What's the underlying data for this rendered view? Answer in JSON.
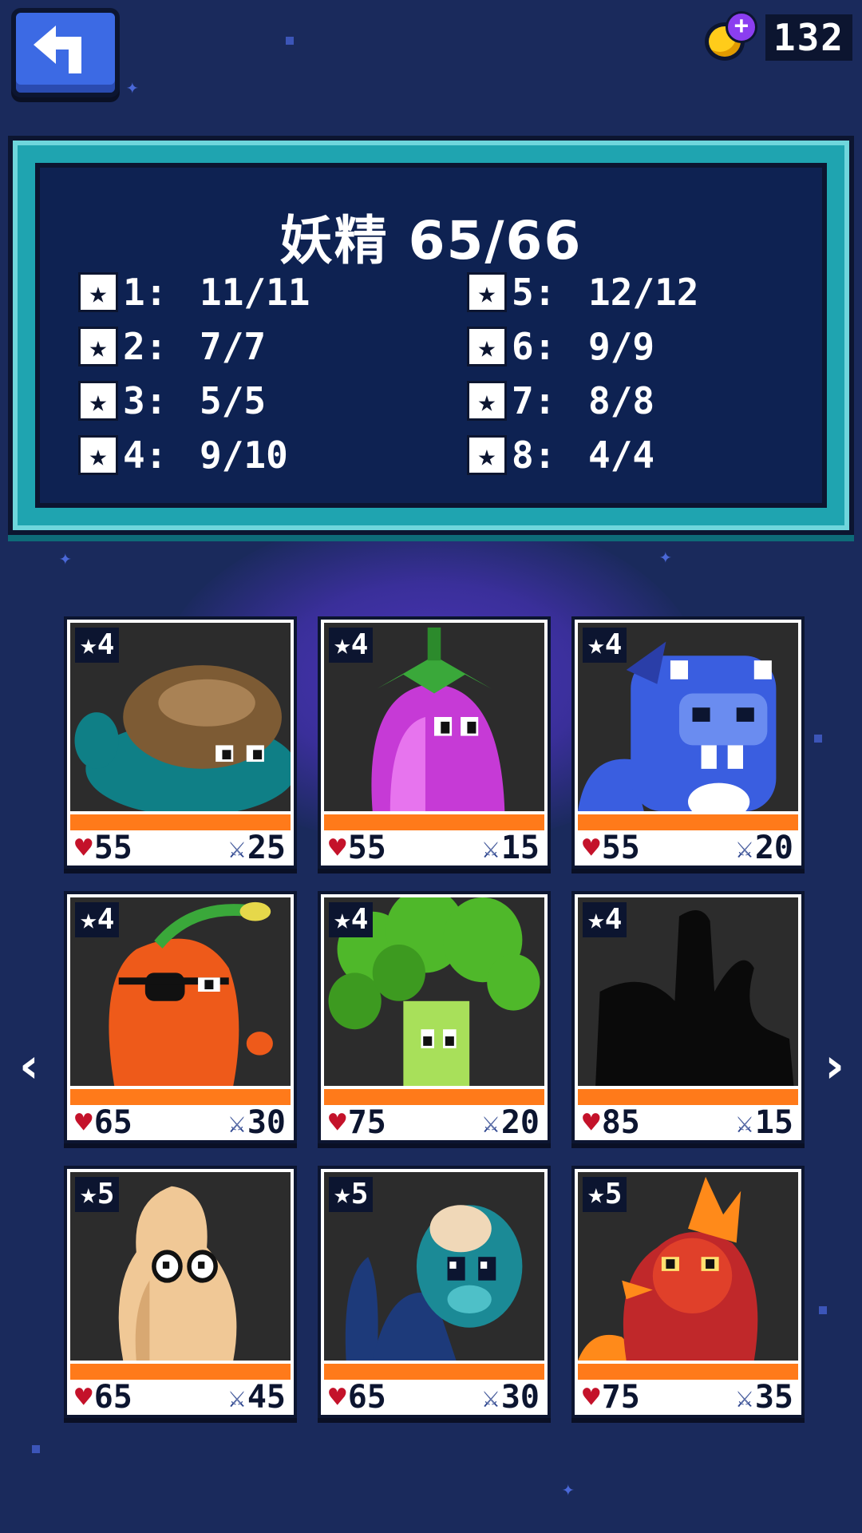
{
  "currency": {
    "icon": "coin-plus-icon",
    "amount": "132"
  },
  "summary": {
    "title": "妖精 65/66",
    "tiers_left": [
      {
        "label": "1:",
        "value": "11/11"
      },
      {
        "label": "2:",
        "value": "7/7"
      },
      {
        "label": "3:",
        "value": "5/5"
      },
      {
        "label": "4:",
        "value": "9/10"
      }
    ],
    "tiers_right": [
      {
        "label": "5:",
        "value": "12/12"
      },
      {
        "label": "6:",
        "value": "9/9"
      },
      {
        "label": "7:",
        "value": "8/8"
      },
      {
        "label": "8:",
        "value": "4/4"
      }
    ]
  },
  "nav": {
    "prev": "‹",
    "next": "›"
  },
  "cards": [
    {
      "creature": "mushroom-blob",
      "tier": "4",
      "hp": "55",
      "atk": "25",
      "colors": {
        "body": "#0f7f86",
        "cap": "#7d5b34"
      }
    },
    {
      "creature": "eggplant",
      "tier": "4",
      "hp": "55",
      "atk": "15",
      "colors": {
        "body": "#c63ad6",
        "leaf": "#3aa83a"
      }
    },
    {
      "creature": "blue-hippo",
      "tier": "4",
      "hp": "55",
      "atk": "20",
      "colors": {
        "body": "#3a5ee0"
      }
    },
    {
      "creature": "carrot-pirate",
      "tier": "4",
      "hp": "65",
      "atk": "30",
      "colors": {
        "body": "#ee5a1a"
      }
    },
    {
      "creature": "broccoli",
      "tier": "4",
      "hp": "75",
      "atk": "20",
      "colors": {
        "body": "#4fb82a"
      }
    },
    {
      "creature": "unknown-silhouette",
      "tier": "4",
      "hp": "85",
      "atk": "15",
      "colors": {
        "body": "#0a0a0a"
      }
    },
    {
      "creature": "peanut",
      "tier": "5",
      "hp": "65",
      "atk": "45",
      "colors": {
        "body": "#f0c896"
      }
    },
    {
      "creature": "teal-mole",
      "tier": "5",
      "hp": "65",
      "atk": "30",
      "colors": {
        "body": "#1b8a96"
      }
    },
    {
      "creature": "fire-chili",
      "tier": "5",
      "hp": "75",
      "atk": "35",
      "colors": {
        "body": "#e0402a"
      }
    }
  ],
  "icons": {
    "heart": "heart-icon",
    "sword": "sword-icon",
    "star": "star-icon",
    "back": "back-arrow-icon"
  }
}
